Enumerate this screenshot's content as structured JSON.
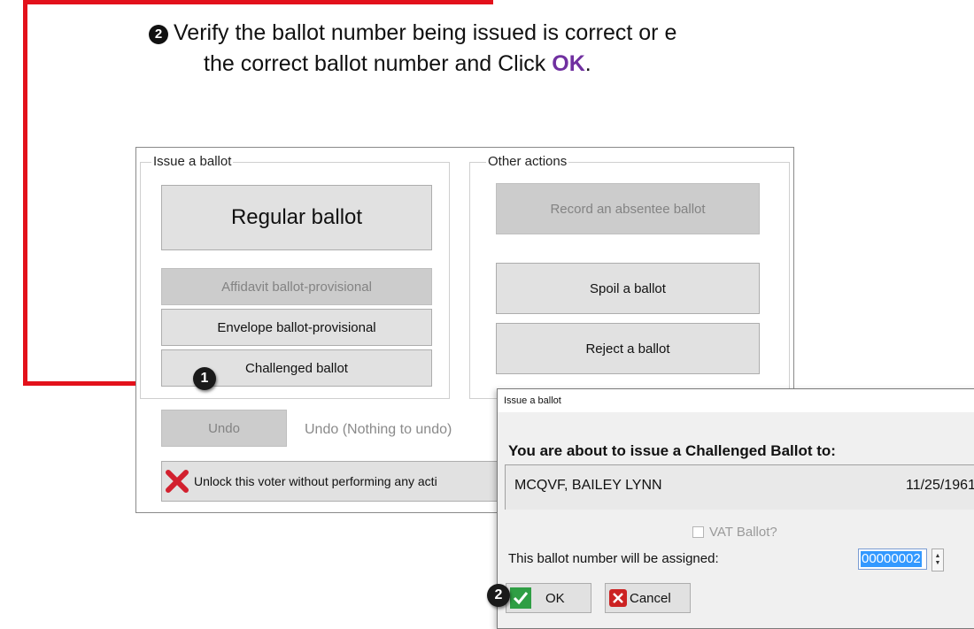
{
  "instruction": {
    "step_number": "2",
    "line1": "Verify the ballot number being issued is correct or e",
    "line2_prefix": "the correct ballot number and Click ",
    "line2_ok": "OK",
    "line2_suffix": "."
  },
  "panel": {
    "issue_group_label": "Issue a ballot",
    "other_group_label": "Other actions",
    "regular_ballot": "Regular ballot",
    "affidavit_ballot": "Affidavit ballot-provisional",
    "envelope_ballot": "Envelope ballot-provisional",
    "challenged_ballot": "Challenged ballot",
    "record_absentee": "Record an absentee ballot",
    "spoil_ballot": "Spoil a ballot",
    "reject_ballot": "Reject a ballot",
    "undo_button": "Undo",
    "undo_status": "Undo (Nothing to undo)",
    "unlock_button": "Unlock this voter without performing any acti",
    "step1_badge": "1"
  },
  "dialog": {
    "title": "Issue a ballot",
    "headline": "You are about to issue a Challenged Ballot to:",
    "voter_name": "MCQVF, BAILEY LYNN",
    "voter_dob": "11/25/1961",
    "vat_label": "VAT Ballot?",
    "assign_label": "This ballot number will be assigned:",
    "ballot_number": "00000002",
    "ok_label": "OK",
    "cancel_label": "Cancel",
    "step2_badge": "2"
  },
  "colors": {
    "connector": "#e3111b",
    "ok_accent": "#7030a0",
    "check_green": "#2f9e44",
    "cancel_red": "#cc2222"
  }
}
